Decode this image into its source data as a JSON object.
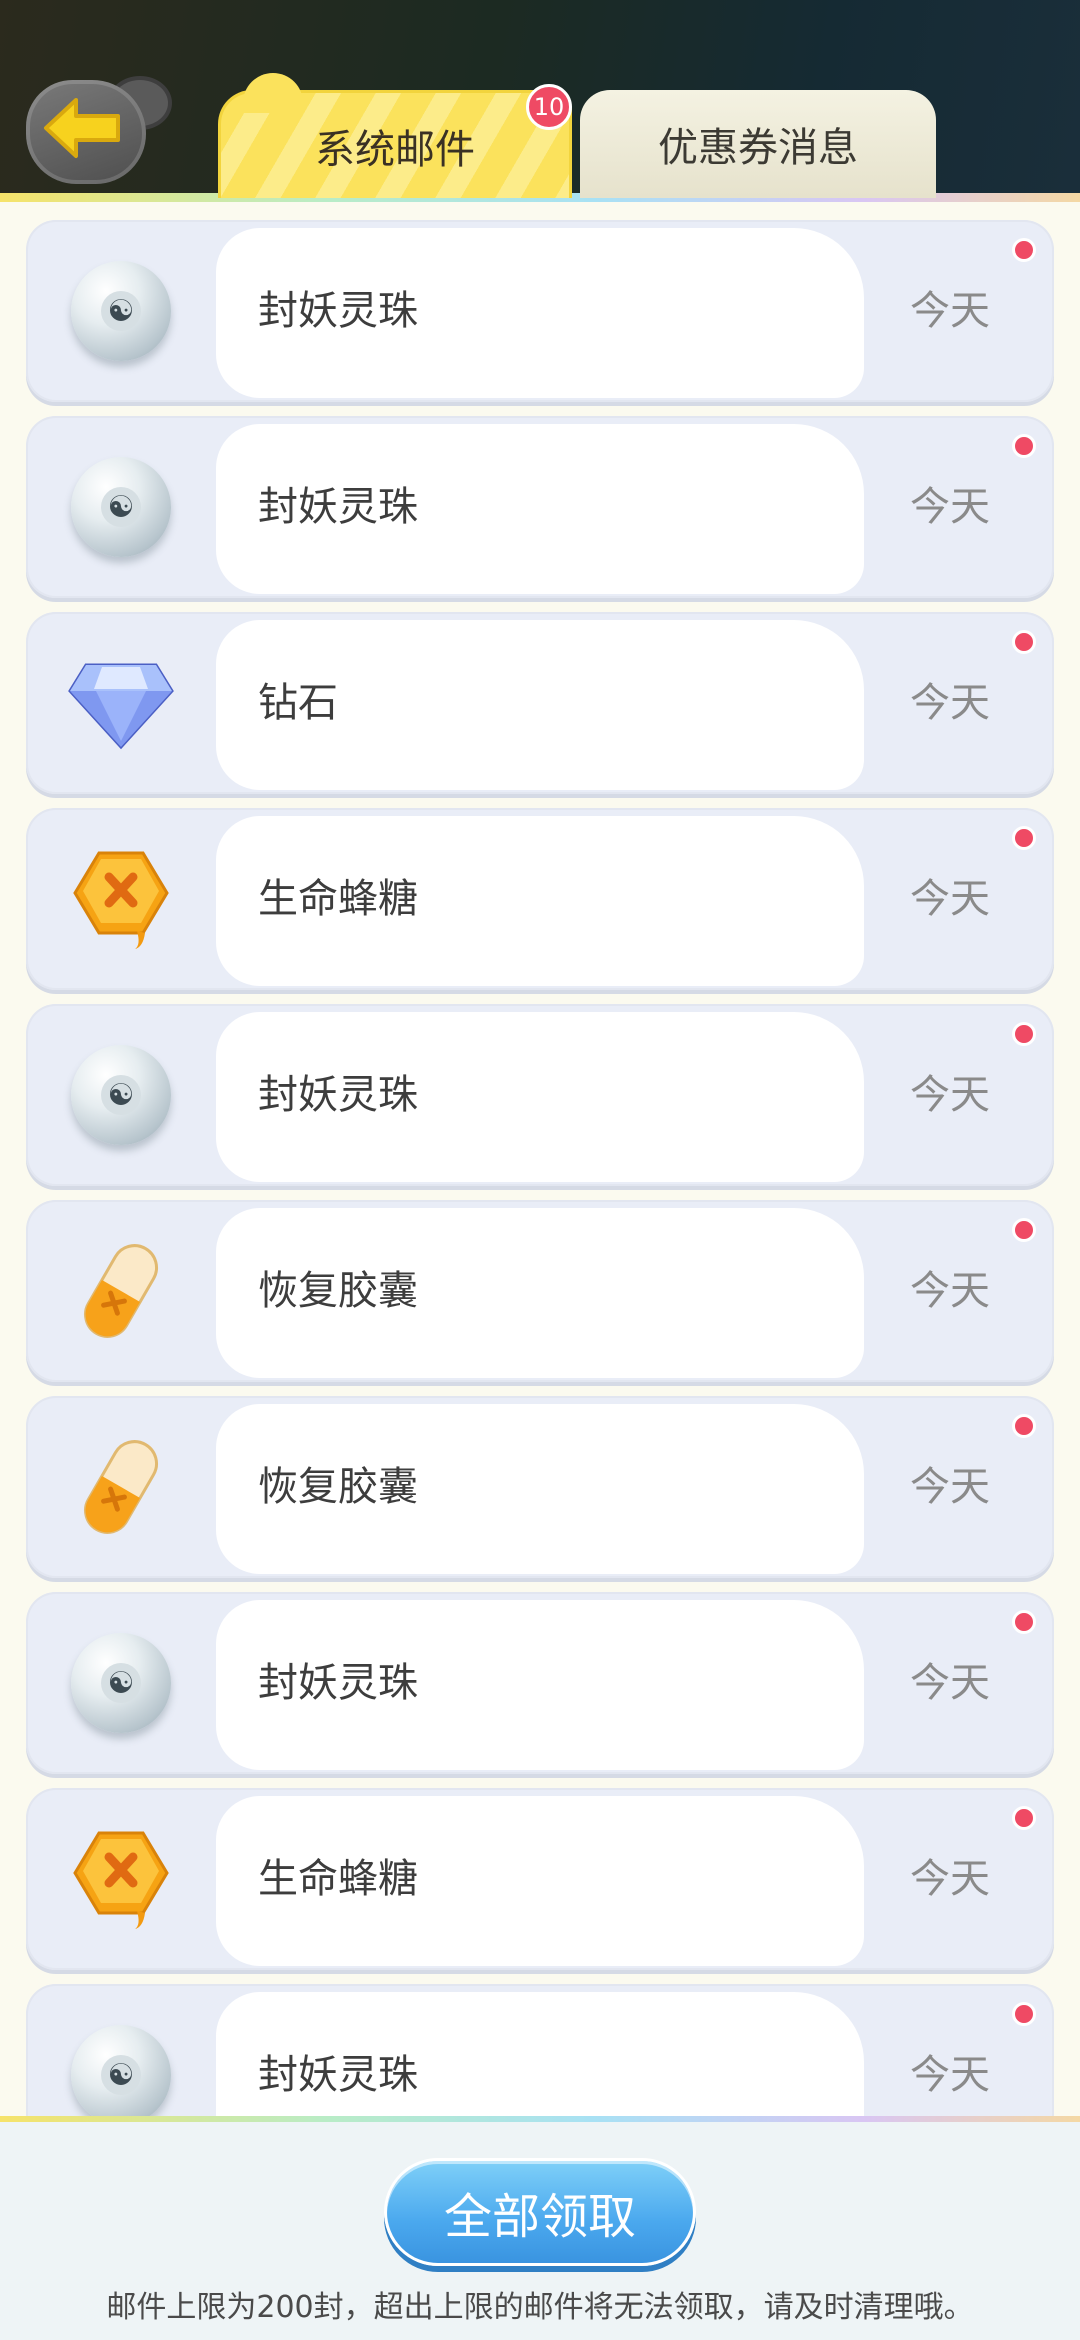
{
  "tabs": {
    "system_mail": "系统邮件",
    "system_mail_badge": "10",
    "coupon_messages": "优惠券消息"
  },
  "mail_items": [
    {
      "name": "封妖灵珠",
      "date": "今天",
      "icon": "spirit-orb-icon"
    },
    {
      "name": "封妖灵珠",
      "date": "今天",
      "icon": "spirit-orb-icon"
    },
    {
      "name": "钻石",
      "date": "今天",
      "icon": "diamond-icon"
    },
    {
      "name": "生命蜂糖",
      "date": "今天",
      "icon": "honey-candy-icon"
    },
    {
      "name": "封妖灵珠",
      "date": "今天",
      "icon": "spirit-orb-icon"
    },
    {
      "name": "恢复胶囊",
      "date": "今天",
      "icon": "recovery-capsule-icon"
    },
    {
      "name": "恢复胶囊",
      "date": "今天",
      "icon": "recovery-capsule-icon"
    },
    {
      "name": "封妖灵珠",
      "date": "今天",
      "icon": "spirit-orb-icon"
    },
    {
      "name": "生命蜂糖",
      "date": "今天",
      "icon": "honey-candy-icon"
    },
    {
      "name": "封妖灵珠",
      "date": "今天",
      "icon": "spirit-orb-icon"
    }
  ],
  "footer": {
    "claim_all": "全部领取",
    "note": "邮件上限为200封，超出上限的邮件将无法领取，请及时清理哦。"
  },
  "colors": {
    "tab_active": "#fbe25c",
    "unread_dot": "#ef4a64",
    "claim_button": "#4aa8ee"
  }
}
